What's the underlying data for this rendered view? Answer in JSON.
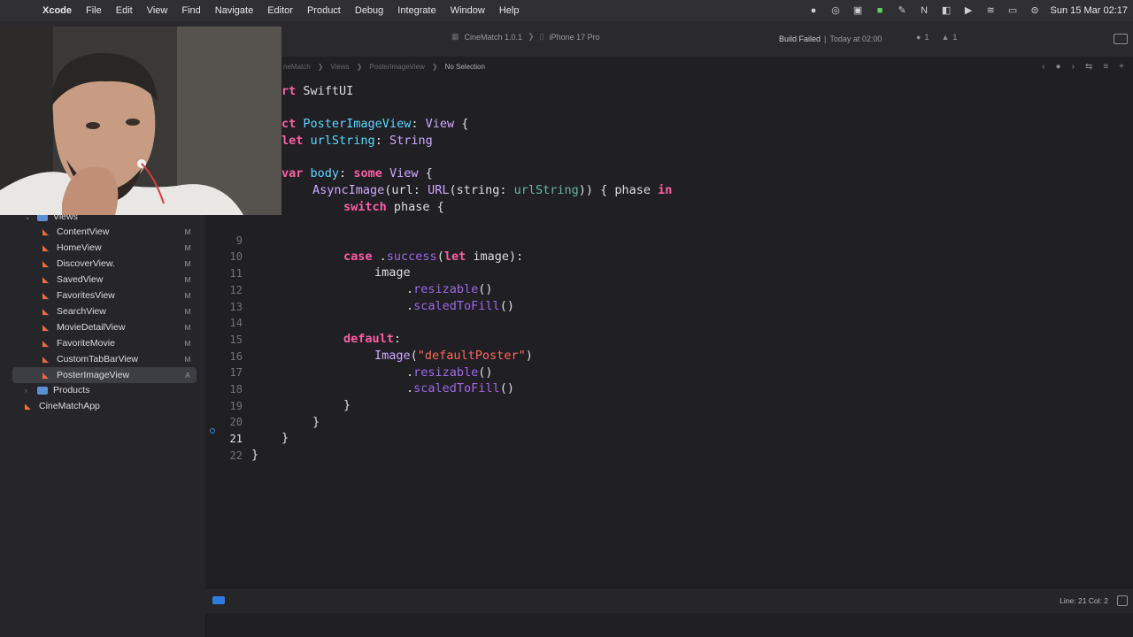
{
  "menubar": {
    "app": "Xcode",
    "items": [
      "File",
      "Edit",
      "View",
      "Find",
      "Navigate",
      "Editor",
      "Product",
      "Debug",
      "Integrate",
      "Window",
      "Help"
    ],
    "clock": "Sun 15 Mar  02:17"
  },
  "toolbar": {
    "scheme": "CineMatch 1.0.1",
    "device": "iPhone 17 Pro",
    "build_status": "Build Failed",
    "build_time": "Today at 02:00",
    "errors": "1",
    "warnings": "1"
  },
  "jumpbar": {
    "crumbs": [
      "neMatch",
      "Views",
      "PosterImageView"
    ],
    "selection": "No Selection"
  },
  "navigator": {
    "group_views": "Views",
    "files": [
      {
        "name": "ContentView",
        "badge": "M"
      },
      {
        "name": "HomeView",
        "badge": "M"
      },
      {
        "name": "DiscoverView.",
        "badge": "M"
      },
      {
        "name": "SavedView",
        "badge": "M"
      },
      {
        "name": "FavoritesView",
        "badge": "M"
      },
      {
        "name": "SearchView",
        "badge": "M"
      },
      {
        "name": "MovieDetailView",
        "badge": "M"
      },
      {
        "name": "FavoriteMovie",
        "badge": "M"
      },
      {
        "name": "CustomTabBarView",
        "badge": "M"
      },
      {
        "name": "PosterImageView",
        "badge": "A"
      }
    ],
    "group_products": "Products",
    "app_file": "CineMatchApp"
  },
  "editor": {
    "line_numbers": [
      "9",
      "10",
      "11",
      "12",
      "13",
      "14",
      "15",
      "16",
      "17",
      "18",
      "19",
      "20",
      "21",
      "22"
    ],
    "current_line": "21"
  },
  "statusbar": {
    "cursor": "Line: 21  Col: 2"
  },
  "colors": {
    "keyword": "#fc5fa3",
    "type": "#d0a8ff",
    "declaration": "#5dd8ff",
    "property": "#67b7a4",
    "function": "#a167e6",
    "string": "#fc6a5d",
    "accent": "#2f7ce0"
  }
}
